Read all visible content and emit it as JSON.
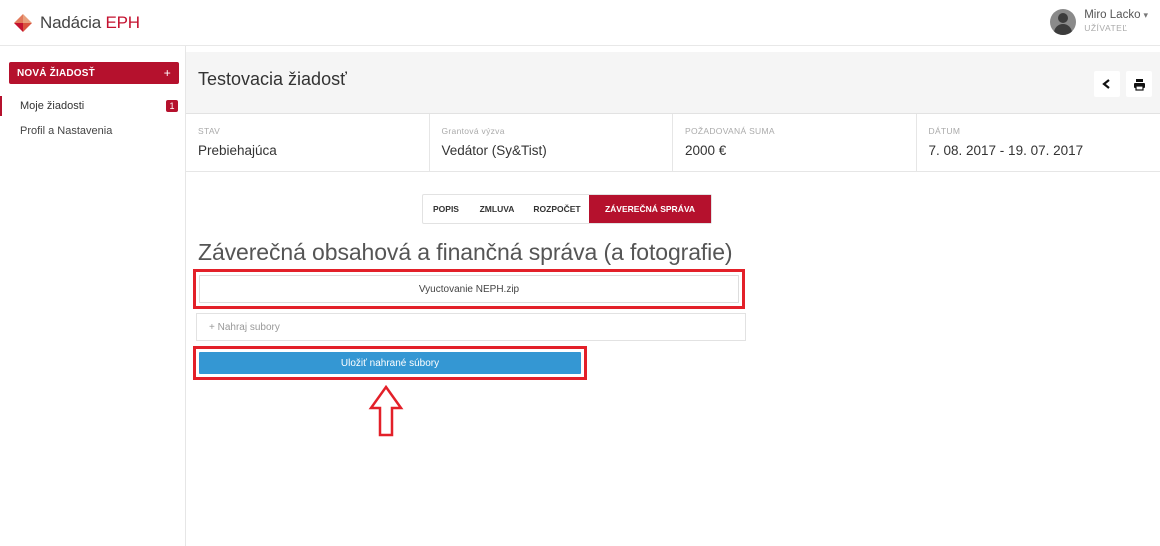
{
  "brand": {
    "name_prefix": "Nadácia ",
    "name_accent": "EPH",
    "accent_color": "#b5112d"
  },
  "user": {
    "name": "Miro Lacko",
    "role": "UŽÍVATEĽ"
  },
  "sidebar": {
    "new_button": {
      "label": "NOVÁ ŽIADOSŤ",
      "plus": "+"
    },
    "items": [
      {
        "label": "Moje žiadosti",
        "badge": "1",
        "active": true
      },
      {
        "label": "Profil a Nastavenia",
        "active": false
      }
    ]
  },
  "header": {
    "title": "Testovacia žiadosť",
    "back_icon": "chevron-left-icon",
    "print_icon": "print-icon"
  },
  "info": [
    {
      "label": "STAV",
      "value": "Prebiehajúca"
    },
    {
      "label": "Grantová výzva",
      "value": "Vedátor (Sy&Tist)"
    },
    {
      "label": "POŽADOVANÁ SUMA",
      "value": "2000 €"
    },
    {
      "label": "DÁTUM",
      "value": "7. 08. 2017 - 19. 07. 2017"
    }
  ],
  "tabs": [
    {
      "label": "POPIS",
      "active": false
    },
    {
      "label": "ZMLUVA",
      "active": false
    },
    {
      "label": "ROZPOČET",
      "active": false
    },
    {
      "label": "ZÁVEREČNÁ SPRÁVA",
      "active": true
    }
  ],
  "section": {
    "title": "Záverečná obsahová a finančná správa (a fotografie)",
    "file_name": "Vyuctovanie NEPH.zip",
    "upload_label": "+ Nahraj subory",
    "save_label": "Uložiť nahrané súbory"
  },
  "colors": {
    "highlight": "#e32029",
    "primary_button": "#3497d3"
  }
}
